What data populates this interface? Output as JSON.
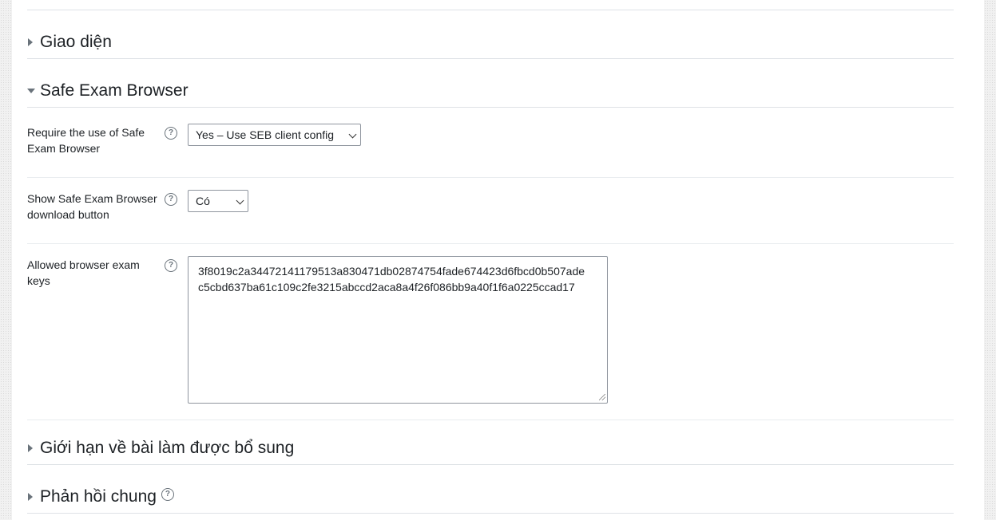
{
  "sections": {
    "giao_dien": {
      "title": "Giao diện",
      "expanded": false
    },
    "seb": {
      "title": "Safe Exam Browser",
      "expanded": true
    },
    "gioi_han": {
      "title": "Giới hạn về bài làm được bổ sung",
      "expanded": false
    },
    "phan_hoi": {
      "title": "Phản hồi chung",
      "expanded": false,
      "has_help": true
    }
  },
  "seb_fields": {
    "require": {
      "label": "Require the use of Safe Exam Browser",
      "value": "Yes – Use SEB client config"
    },
    "download_button": {
      "label": "Show Safe Exam Browser download button",
      "value": "Có"
    },
    "exam_keys": {
      "label": "Allowed browser exam keys",
      "value": "3f8019c2a34472141179513a830471db02874754fade674423d6fbcd0b507ade\nc5cbd637ba61c109c2fe3215abccd2aca8a4f26f086bb9a40f1f6a0225ccad17"
    }
  },
  "icons": {
    "help": "question-circle",
    "collapsed": "caret-right",
    "expanded": "caret-down"
  },
  "colors": {
    "text": "#1d2125",
    "border": "#dee2e6",
    "icon": "#6a737b"
  }
}
